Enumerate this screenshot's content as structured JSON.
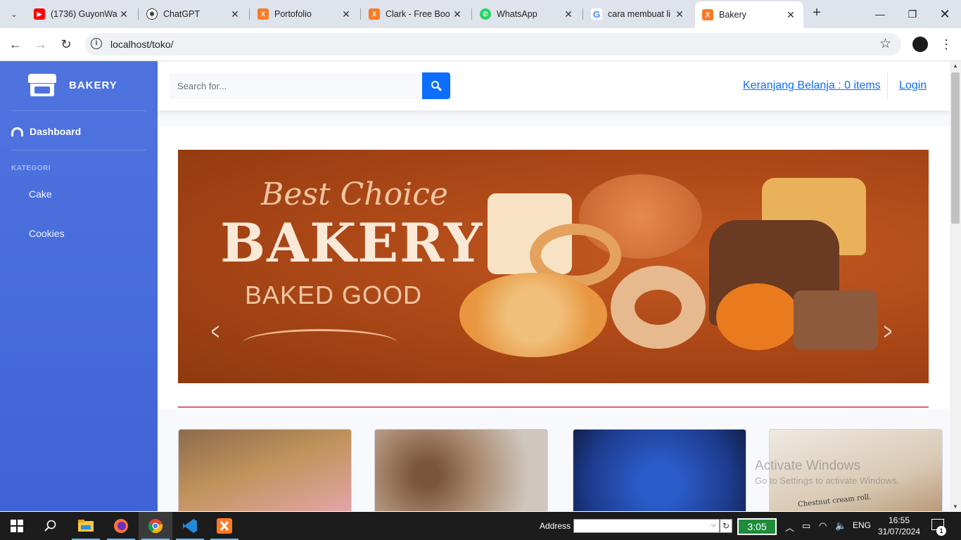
{
  "browser": {
    "tabs": [
      {
        "title": "(1736) GuyonWa",
        "icon": "youtube-icon",
        "color": "#ff0000"
      },
      {
        "title": "ChatGPT",
        "icon": "chatgpt-icon",
        "color": "#333333"
      },
      {
        "title": "Portofolio",
        "icon": "xampp-icon",
        "color": "#fb7a24"
      },
      {
        "title": "Clark - Free Boo",
        "icon": "xampp-icon",
        "color": "#fb7a24"
      },
      {
        "title": "WhatsApp",
        "icon": "whatsapp-icon",
        "color": "#25d366"
      },
      {
        "title": "cara membuat li",
        "icon": "google-icon",
        "color": "#4285f4"
      },
      {
        "title": "Bakery",
        "icon": "xampp-icon",
        "color": "#fb7a24"
      }
    ],
    "url": "localhost/toko/"
  },
  "sidebar": {
    "brand": "BAKERY",
    "dashboard": "Dashboard",
    "heading": "KATEGORI",
    "items": [
      "Cake",
      "Cookies"
    ]
  },
  "topbar": {
    "search_placeholder": "Search for...",
    "cart": "Keranjang Belanja : 0 items",
    "login": "Login"
  },
  "banner": {
    "line1": "Best Choice",
    "line2": "BAKERY",
    "line3": "BAKED GOOD"
  },
  "products": [
    {
      "label": "",
      "color": "#7a5a3a"
    },
    {
      "label": "",
      "color": "#6b4a36"
    },
    {
      "label": "",
      "color": "#2c4fa8"
    },
    {
      "label": "Chestnut cream roll.",
      "color": "#d8d1c6"
    }
  ],
  "watermark": {
    "line1": "Activate Windows",
    "line2": "Go to Settings to activate Windows."
  },
  "taskbar": {
    "address_label": "Address",
    "timer": "3:05",
    "lang": "ENG",
    "time": "16:55",
    "date": "31/07/2024",
    "notifications": "1"
  }
}
